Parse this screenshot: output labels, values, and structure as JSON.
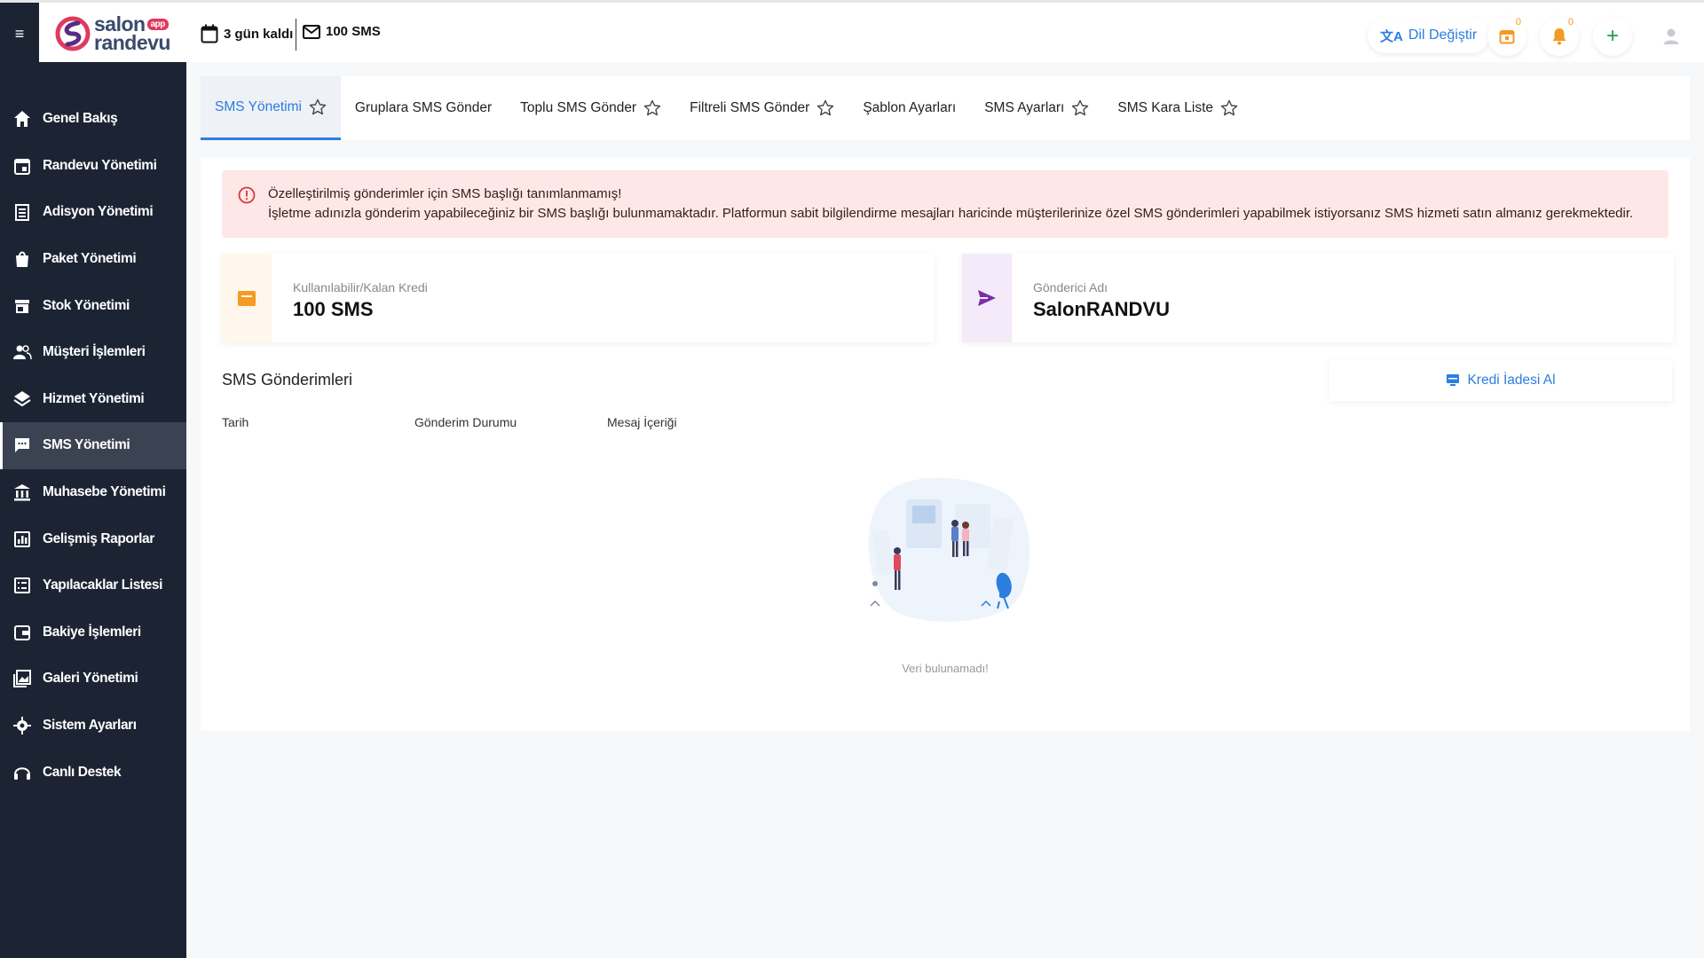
{
  "header": {
    "logo": {
      "line1": "salon",
      "line2": "randevu",
      "badge": "app"
    },
    "trial_text": "3 gün kaldı",
    "sms_text": "100 SMS",
    "language_button": "Dil Değiştir",
    "calendar_badge": "0",
    "notification_badge": "0"
  },
  "sidebar": {
    "items": [
      {
        "label": "Genel Bakış",
        "icon": "home-icon"
      },
      {
        "label": "Randevu Yönetimi",
        "icon": "calendar-icon"
      },
      {
        "label": "Adisyon Yönetimi",
        "icon": "receipt-icon"
      },
      {
        "label": "Paket Yönetimi",
        "icon": "bag-icon"
      },
      {
        "label": "Stok Yönetimi",
        "icon": "store-icon"
      },
      {
        "label": "Müşteri İşlemleri",
        "icon": "users-icon"
      },
      {
        "label": "Hizmet Yönetimi",
        "icon": "layers-icon"
      },
      {
        "label": "SMS Yönetimi",
        "icon": "message-icon"
      },
      {
        "label": "Muhasebe Yönetimi",
        "icon": "bank-icon"
      },
      {
        "label": "Gelişmiş Raporlar",
        "icon": "chart-icon"
      },
      {
        "label": "Yapılacaklar Listesi",
        "icon": "list-icon"
      },
      {
        "label": "Bakiye İşlemleri",
        "icon": "wallet-icon"
      },
      {
        "label": "Galeri Yönetimi",
        "icon": "gallery-icon"
      },
      {
        "label": "Sistem Ayarları",
        "icon": "gear-icon"
      },
      {
        "label": "Canlı Destek",
        "icon": "headset-icon"
      }
    ],
    "active_index": 7
  },
  "tabs": [
    {
      "label": "SMS Yönetimi",
      "star": true,
      "active": true
    },
    {
      "label": "Gruplara SMS Gönder",
      "star": false
    },
    {
      "label": "Toplu SMS Gönder",
      "star": true
    },
    {
      "label": "Filtreli SMS Gönder",
      "star": true
    },
    {
      "label": "Şablon Ayarları",
      "star": false
    },
    {
      "label": "SMS Ayarları",
      "star": true
    },
    {
      "label": "SMS Kara Liste",
      "star": true
    }
  ],
  "alert": {
    "title": "Özelleştirilmiş gönderimler için SMS başlığı tanımlanmamış!",
    "message": "İşletme adınızla gönderim yapabileceğiniz bir SMS başlığı bulunmamaktadır. Platformun sabit bilgilendirme mesajları haricinde müşterilerinize özel SMS gönderimleri yapabilmek istiyorsanız SMS hizmeti satın almanız gerekmektedir."
  },
  "stats": {
    "credit": {
      "label": "Kullanılabilir/Kalan Kredi",
      "value": "100 SMS",
      "icon": "folder-icon",
      "color": "#f59a23"
    },
    "sender": {
      "label": "Gönderici Adı",
      "value": "SalonRANDVU",
      "icon": "send-icon",
      "color": "#7b2fa8"
    }
  },
  "section": {
    "title": "SMS Gönderimleri",
    "refund_button": "Kredi İadesi Al",
    "columns": [
      "Tarih",
      "Gönderim Durumu",
      "Mesaj İçeriği"
    ],
    "empty_text": "Veri bulunamadı!"
  },
  "colors": {
    "sidebar_bg": "#1c2434",
    "accent": "#2b7de0",
    "alert_bg": "#fde8e7"
  }
}
